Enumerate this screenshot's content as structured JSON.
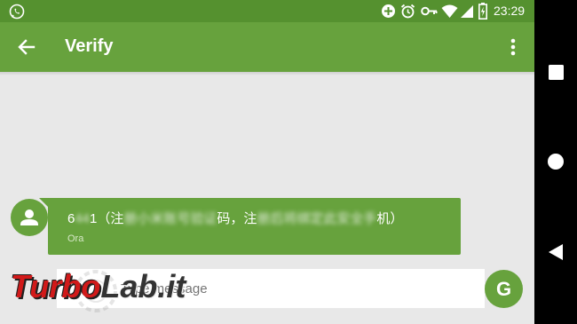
{
  "status_bar": {
    "time": "23:29",
    "left_icon": "whatsapp-icon",
    "right_icons": [
      "data-saver-icon",
      "alarm-icon",
      "vpn-key-icon",
      "wifi-icon",
      "signal-icon",
      "battery-charging-icon"
    ]
  },
  "app_bar": {
    "title": "Verify",
    "back_icon": "arrow-back-icon",
    "menu_icon": "more-vert-icon"
  },
  "message": {
    "text_start": "6",
    "text_blur_1": "44",
    "text_mid_1": "1（注",
    "text_blur_2": "册小米账号验证",
    "text_mid_2": "码，注",
    "text_blur_3": "册后将绑定此安全手",
    "text_end": "机）",
    "time": "Ora",
    "avatar_icon": "person-icon"
  },
  "compose": {
    "placeholder": "Type message",
    "send_avatar_letter": "G"
  },
  "watermark": {
    "part1": "Turbo",
    "part2": "Lab.it"
  },
  "navigation_bar": {
    "buttons": [
      "overview-square-icon",
      "home-circle-icon",
      "back-triangle-icon"
    ]
  },
  "colors": {
    "primary": "#67a23d",
    "primary_dark": "#55912f",
    "background": "#e8e8e8"
  }
}
